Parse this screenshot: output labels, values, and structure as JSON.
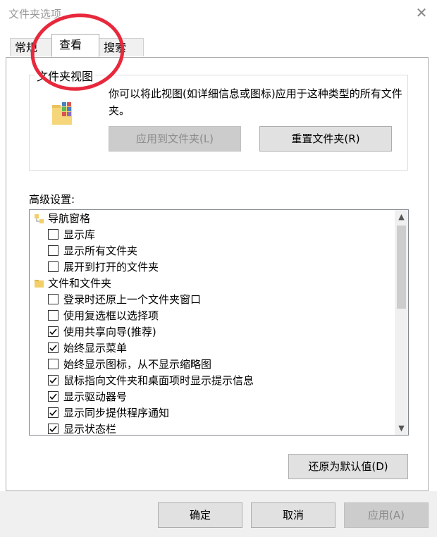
{
  "window": {
    "title": "文件夹选项",
    "close_glyph": "✕"
  },
  "tabs": [
    {
      "label": "常规",
      "active": false
    },
    {
      "label": "查看",
      "active": true
    },
    {
      "label": "搜索",
      "active": false
    }
  ],
  "folder_view": {
    "legend": "文件夹视图",
    "description": "你可以将此视图(如详细信息或图标)应用于这种类型的所有文件夹。",
    "apply_to_folders": "应用到文件夹(L)",
    "reset_folders": "重置文件夹(R)"
  },
  "advanced": {
    "label": "高级设置:",
    "items": [
      {
        "type": "category",
        "label": "导航窗格"
      },
      {
        "type": "checkbox",
        "label": "显示库",
        "checked": false
      },
      {
        "type": "checkbox",
        "label": "显示所有文件夹",
        "checked": false
      },
      {
        "type": "checkbox",
        "label": "展开到打开的文件夹",
        "checked": false
      },
      {
        "type": "category",
        "label": "文件和文件夹"
      },
      {
        "type": "checkbox",
        "label": "登录时还原上一个文件夹窗口",
        "checked": false
      },
      {
        "type": "checkbox",
        "label": "使用复选框以选择项",
        "checked": false
      },
      {
        "type": "checkbox",
        "label": "使用共享向导(推荐)",
        "checked": true
      },
      {
        "type": "checkbox",
        "label": "始终显示菜单",
        "checked": true
      },
      {
        "type": "checkbox",
        "label": "始终显示图标，从不显示缩略图",
        "checked": false
      },
      {
        "type": "checkbox",
        "label": "鼠标指向文件夹和桌面项时显示提示信息",
        "checked": true
      },
      {
        "type": "checkbox",
        "label": "显示驱动器号",
        "checked": true
      },
      {
        "type": "checkbox",
        "label": "显示同步提供程序通知",
        "checked": true
      },
      {
        "type": "checkbox",
        "label": "显示状态栏",
        "checked": true
      }
    ],
    "scroll_up_glyph": "▲",
    "scroll_down_glyph": "▼"
  },
  "restore_defaults": "还原为默认值(D)",
  "footer": {
    "ok": "确定",
    "cancel": "取消",
    "apply": "应用(A)"
  },
  "annotation": {
    "color": "#e8283c"
  }
}
